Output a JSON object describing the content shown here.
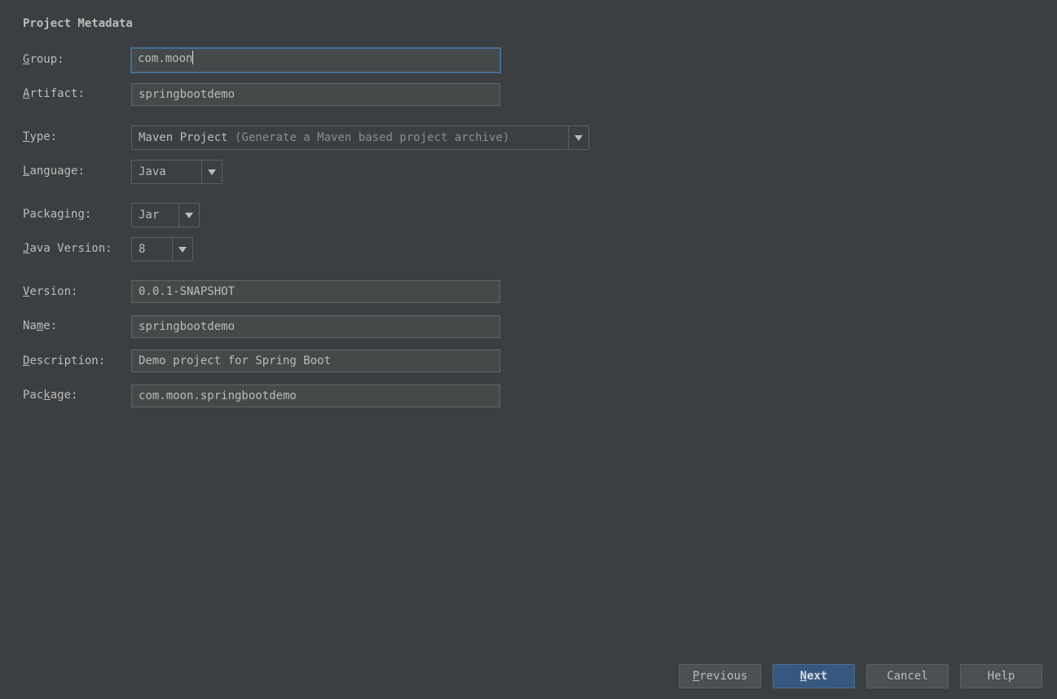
{
  "section_title": "Project Metadata",
  "fields": {
    "group": {
      "label_pre": "",
      "label_mn": "G",
      "label_post": "roup:",
      "value": "com.moon"
    },
    "artifact": {
      "label_pre": "",
      "label_mn": "A",
      "label_post": "rtifact:",
      "value": "springbootdemo"
    },
    "type": {
      "label_pre": "",
      "label_mn": "T",
      "label_post": "ype:",
      "value": "Maven Project",
      "hint": "(Generate a Maven based project archive)"
    },
    "language": {
      "label_pre": "",
      "label_mn": "L",
      "label_post": "anguage:",
      "value": "Java"
    },
    "packaging": {
      "label_pre": "Packa",
      "label_mn": "g",
      "label_post": "ing:",
      "value": "Jar"
    },
    "java_version": {
      "label_pre": "",
      "label_mn": "J",
      "label_post": "ava Version:",
      "value": "8"
    },
    "version": {
      "label_pre": "",
      "label_mn": "V",
      "label_post": "ersion:",
      "value": "0.0.1-SNAPSHOT"
    },
    "name": {
      "label_pre": "Na",
      "label_mn": "m",
      "label_post": "e:",
      "value": "springbootdemo"
    },
    "description": {
      "label_pre": "",
      "label_mn": "D",
      "label_post": "escription:",
      "value": "Demo project for Spring Boot"
    },
    "package": {
      "label_pre": "Pac",
      "label_mn": "k",
      "label_post": "age:",
      "value": "com.moon.springbootdemo"
    }
  },
  "buttons": {
    "previous": {
      "pre": "",
      "mn": "P",
      "post": "revious"
    },
    "next": {
      "pre": "",
      "mn": "N",
      "post": "ext"
    },
    "cancel": {
      "label": "Cancel"
    },
    "help": {
      "label": "Help"
    }
  },
  "colors": {
    "background": "#3c3f41",
    "field_bg": "#45494a",
    "focus_border": "#466d94",
    "primary_button": "#365880"
  }
}
